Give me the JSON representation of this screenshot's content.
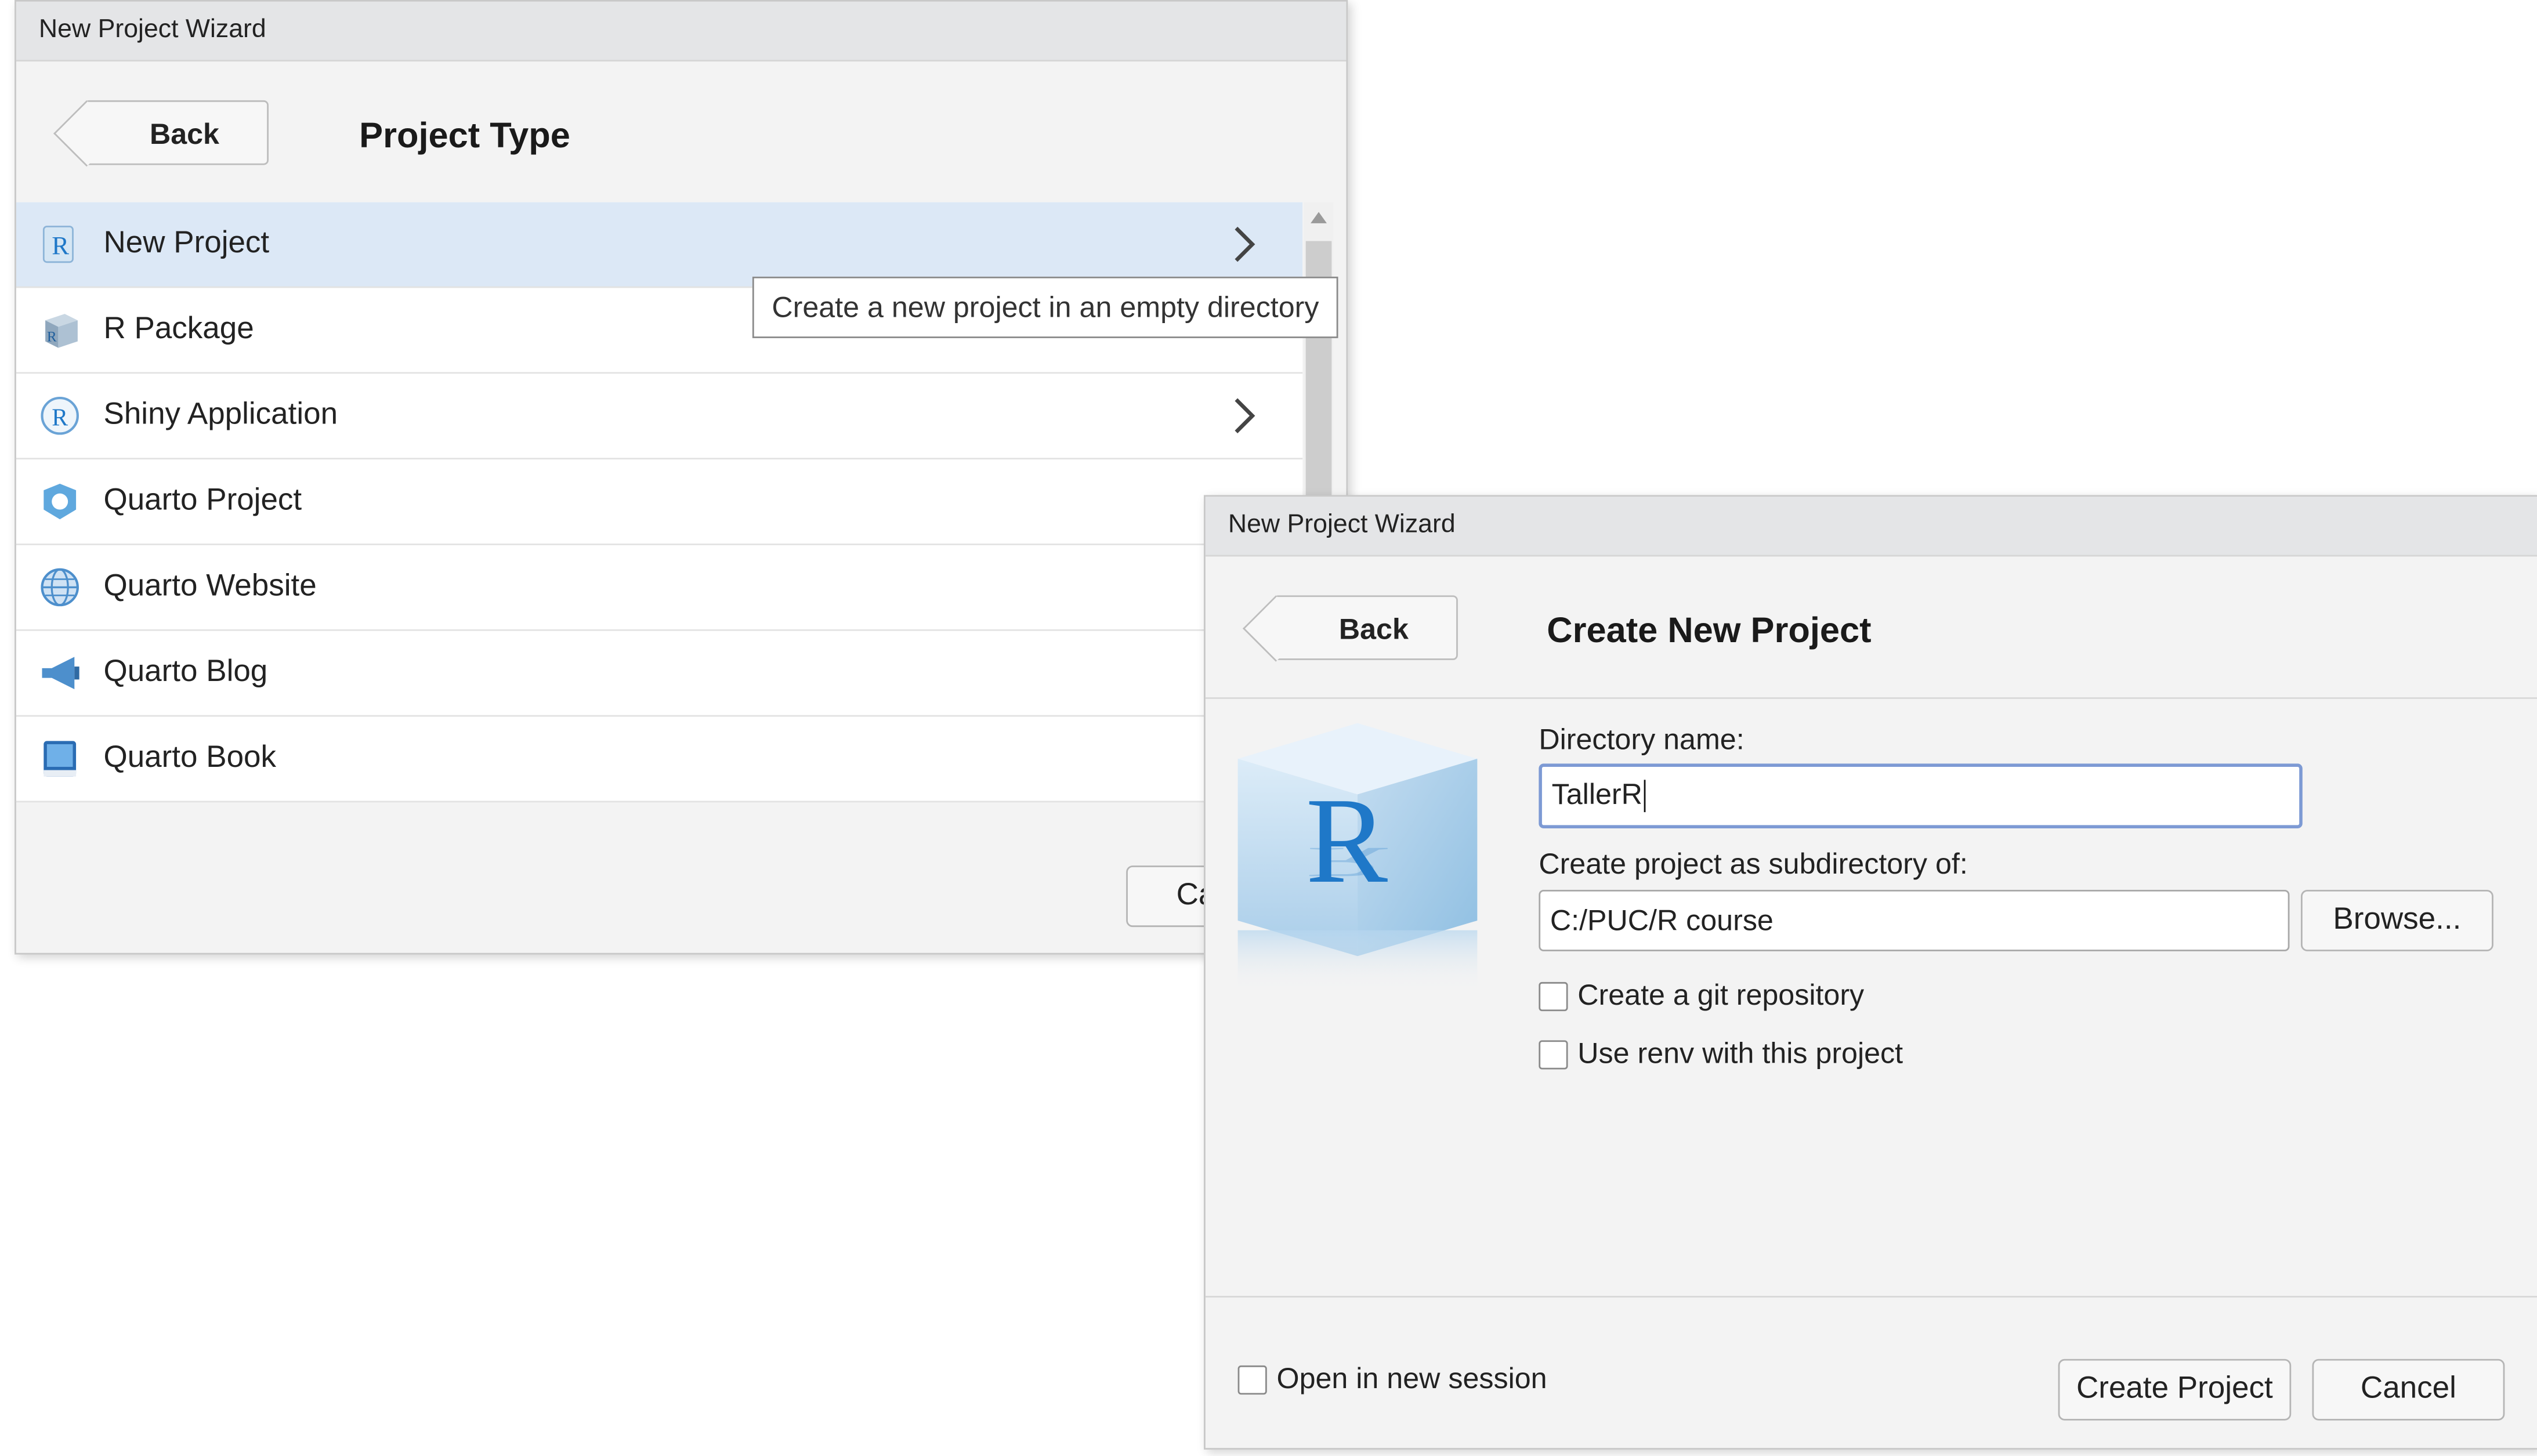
{
  "dialog1": {
    "title": "New Project Wizard",
    "back_label": "Back",
    "heading": "Project Type",
    "items": [
      {
        "label": "New Project",
        "icon": "r-project-icon",
        "selected": true
      },
      {
        "label": "R Package",
        "icon": "r-package-icon"
      },
      {
        "label": "Shiny Application",
        "icon": "shiny-icon"
      },
      {
        "label": "Quarto Project",
        "icon": "quarto-project-icon"
      },
      {
        "label": "Quarto Website",
        "icon": "quarto-website-icon"
      },
      {
        "label": "Quarto Blog",
        "icon": "quarto-blog-icon"
      },
      {
        "label": "Quarto Book",
        "icon": "quarto-book-icon"
      }
    ],
    "tooltip": "Create a new project in an empty directory",
    "cancel_label_partial": "Ca"
  },
  "dialog2": {
    "title": "New Project Wizard",
    "back_label": "Back",
    "heading": "Create New Project",
    "logo_letter": "R",
    "directory_name_label": "Directory name:",
    "directory_name_value": "TallerR",
    "subdirectory_label": "Create project as subdirectory of:",
    "subdirectory_value": "C:/PUC/R course",
    "browse_label": "Browse...",
    "git_label": "Create a git repository",
    "git_checked": false,
    "renv_label": "Use renv with this project",
    "renv_checked": false,
    "new_session_label": "Open in new session",
    "new_session_checked": false,
    "create_label": "Create Project",
    "cancel_label": "Cancel"
  },
  "colors": {
    "selected_row": "#dce8f6",
    "dialog_bg": "#f3f3f3",
    "titlebar_bg": "#e4e5e7",
    "focus_border": "#7d9ad4",
    "r_blue": "#1f78c8"
  }
}
